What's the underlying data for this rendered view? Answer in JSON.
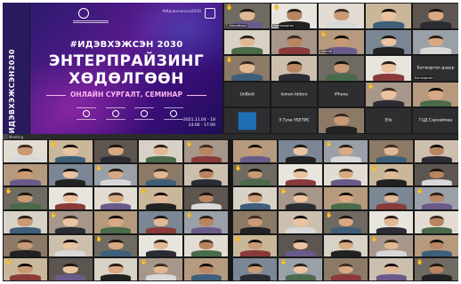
{
  "side_hashtag": "#ИДЭВХЭЖСЭН2030",
  "slide": {
    "top_hashtag": "#Идэвхэжсэн2030",
    "tag": "#ИДЭВХЭЖСЭН 2030",
    "title_line1": "ЭНТЕРПРАЙЗИНГ",
    "title_line2": "ХӨДӨЛГӨӨН",
    "subtitle": "ОНЛАЙН СУРГАЛТ, СЕМИНАР",
    "date_line1": "2021.11.04 - 18",
    "date_line2": "14:00 - 17:00"
  },
  "bar_label": "Meeting",
  "colors": {
    "hand": "#f4c542",
    "tile_bg": "#2e2e30",
    "slide_accent": "#ffb4f0"
  },
  "top_tiles": [
    {
      "name": "Г.Энхсайхан",
      "hand": true,
      "kind": "person"
    },
    {
      "name": "Мөнхжаргал",
      "hand": true,
      "kind": "person"
    },
    {
      "name": "",
      "hand": false,
      "kind": "person"
    },
    {
      "name": "",
      "hand": false,
      "kind": "person"
    },
    {
      "name": "",
      "hand": false,
      "kind": "person"
    },
    {
      "name": "",
      "hand": false,
      "kind": "person"
    },
    {
      "name": "",
      "hand": false,
      "kind": "person"
    },
    {
      "name": "Хангай",
      "hand": true,
      "kind": "person"
    },
    {
      "name": "",
      "hand": false,
      "kind": "person"
    },
    {
      "name": "",
      "hand": false,
      "kind": "person"
    },
    {
      "name": "",
      "hand": true,
      "kind": "person"
    },
    {
      "name": "",
      "hand": false,
      "kind": "person"
    },
    {
      "name": "",
      "hand": false,
      "kind": "person"
    },
    {
      "name": "",
      "hand": false,
      "kind": "person"
    },
    {
      "name": "Батжаргал",
      "hand": false,
      "kind": "text",
      "center": "Батжаргал дэдер"
    },
    {
      "name": "",
      "hand": false,
      "kind": "text",
      "center": "UnBold"
    },
    {
      "name": "",
      "hand": false,
      "kind": "text",
      "center": "Iomon Iddorn"
    },
    {
      "name": "",
      "hand": false,
      "kind": "text",
      "center": "iPhone"
    },
    {
      "name": "",
      "hand": true,
      "kind": "person"
    },
    {
      "name": "",
      "hand": false,
      "kind": "person"
    },
    {
      "name": "",
      "hand": false,
      "kind": "logo"
    },
    {
      "name": "",
      "hand": false,
      "kind": "text",
      "center": "Э.Туяа УБЕТИС"
    },
    {
      "name": "",
      "hand": false,
      "kind": "person"
    },
    {
      "name": "",
      "hand": false,
      "kind": "text",
      "center": "Elle"
    },
    {
      "name": "",
      "hand": false,
      "kind": "text",
      "center": "ГЦД Сарнаймаа"
    }
  ],
  "bottom_left_count": 30,
  "bottom_right_count": 30
}
